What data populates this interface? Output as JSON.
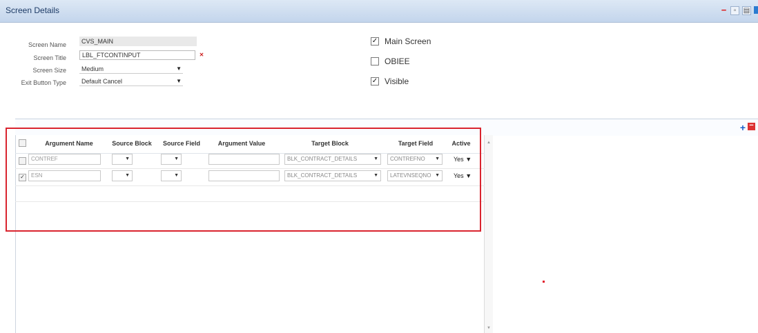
{
  "header": {
    "title": "Screen Details"
  },
  "form": {
    "screen_name_label": "Screen Name",
    "screen_name_value": "CVS_MAIN",
    "screen_title_label": "Screen Title",
    "screen_title_value": "LBL_FTCONTINPUT",
    "screen_size_label": "Screen Size",
    "screen_size_value": "Medium",
    "exit_button_label": "Exit Button Type",
    "exit_button_value": "Default Cancel"
  },
  "checkboxes": {
    "main_screen": {
      "label": "Main Screen",
      "checked": true
    },
    "obiee": {
      "label": "OBIEE",
      "checked": false
    },
    "visible": {
      "label": "Visible",
      "checked": true
    }
  },
  "grid": {
    "columns": [
      "Argument Name",
      "Source Block",
      "Source Field",
      "Argument Value",
      "Target Block",
      "Target Field",
      "Active"
    ],
    "rows": [
      {
        "checked": false,
        "argument_name": "CONTREF",
        "source_block": "",
        "source_field": "",
        "argument_value": "",
        "target_block": "BLK_CONTRACT_DETAILS",
        "target_field": "CONTREFNO",
        "active": "Yes"
      },
      {
        "checked": true,
        "argument_name": "ESN",
        "source_block": "",
        "source_field": "",
        "argument_value": "",
        "target_block": "BLK_CONTRACT_DETAILS",
        "target_field": "LATEVNSEQNO",
        "active": "Yes"
      }
    ]
  },
  "icons": {
    "add": "plus-icon",
    "delete": "minus-icon",
    "dropdown": "chevron-down-icon"
  },
  "colors": {
    "header_bg": "#c3d5ec",
    "highlight": "#d9232e",
    "add": "#1a5fc8",
    "delete": "#d33"
  }
}
